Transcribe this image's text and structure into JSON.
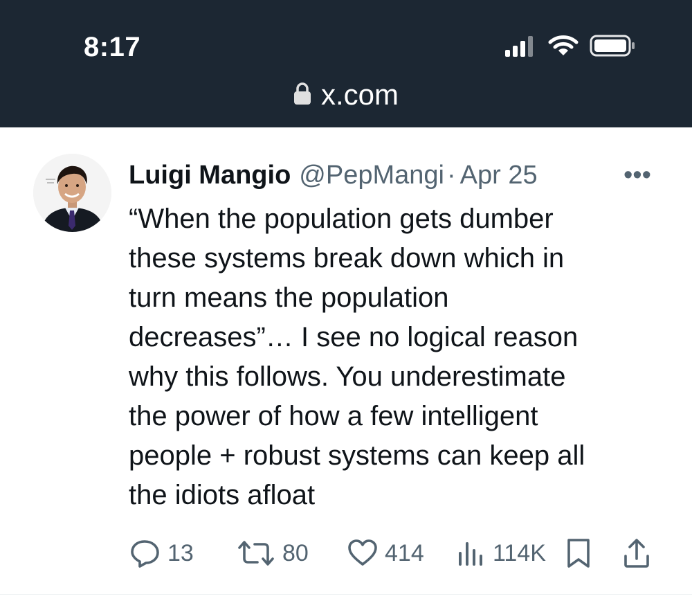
{
  "status_bar": {
    "time": "8:17",
    "url": "x.com",
    "icons": [
      "cellular-signal-icon",
      "wifi-icon",
      "battery-icon"
    ]
  },
  "tweet": {
    "author_name": "Luigi Mangio",
    "author_handle": "@PepMangi",
    "separator": "·",
    "date": "Apr 25",
    "more_label": "•••",
    "text": "“When the population gets dumber\nthese systems break down which in\nturn means the population\ndecreases”… I see no logical reason\nwhy this follows. You underestimate\nthe power of how a few intelligent\npeople + robust systems can keep all\nthe idiots afloat",
    "stats": {
      "replies": "13",
      "reposts": "80",
      "likes": "414",
      "views": "114K"
    }
  },
  "colors": {
    "status_bar_bg": "#1c2733",
    "text_primary": "#0f1419",
    "text_secondary": "#536471"
  }
}
